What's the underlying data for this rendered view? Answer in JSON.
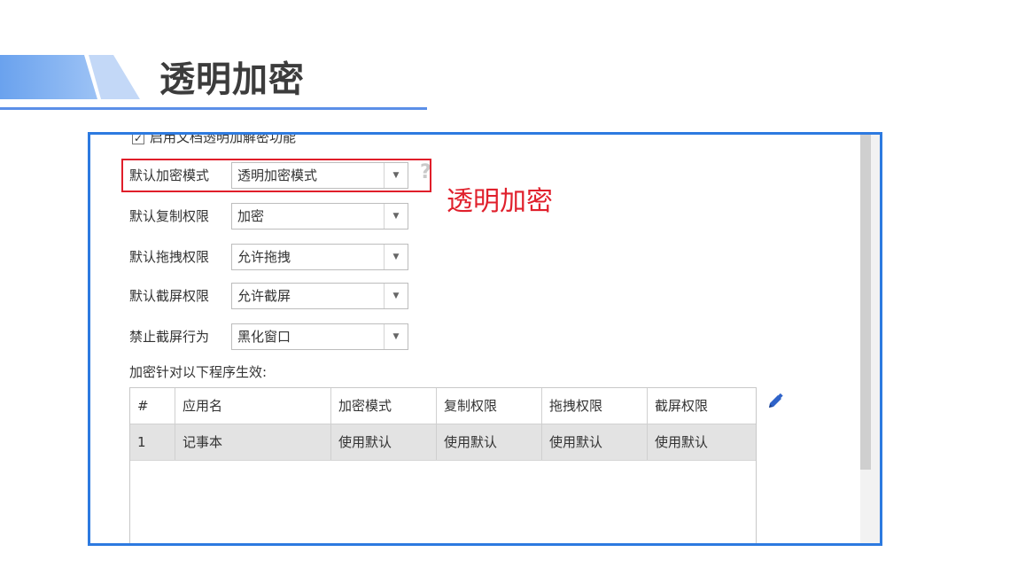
{
  "slide": {
    "title": "透明加密",
    "colors": {
      "accent": "#5b8fe8",
      "highlight": "#e01e2a",
      "frame": "#2d7ae0"
    }
  },
  "settings": {
    "enable_checkbox": {
      "label": "启用文档透明加解密功能",
      "checked": true
    },
    "fields": [
      {
        "label": "默认加密模式",
        "value": "透明加密模式"
      },
      {
        "label": "默认复制权限",
        "value": "加密"
      },
      {
        "label": "默认拖拽权限",
        "value": "允许拖拽"
      },
      {
        "label": "默认截屏权限",
        "value": "允许截屏"
      },
      {
        "label": "禁止截屏行为",
        "value": "黑化窗口"
      }
    ],
    "help_icon": "?",
    "annotation": "透明加密",
    "programs_label": "加密针对以下程序生效:"
  },
  "table": {
    "columns": [
      "#",
      "应用名",
      "加密模式",
      "复制权限",
      "拖拽权限",
      "截屏权限"
    ],
    "rows": [
      [
        "1",
        "记事本",
        "使用默认",
        "使用默认",
        "使用默认",
        "使用默认"
      ]
    ],
    "edit_icon": "pencil-icon"
  }
}
